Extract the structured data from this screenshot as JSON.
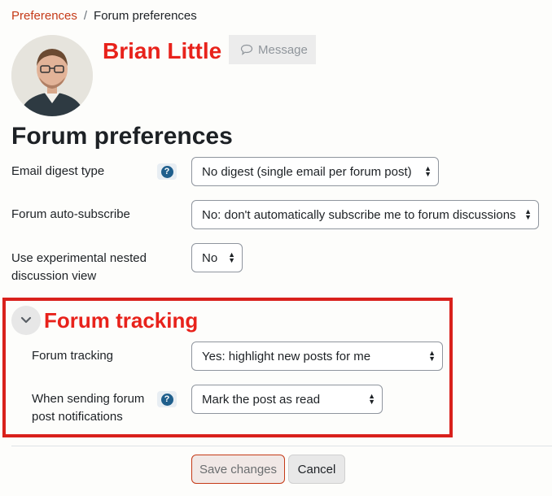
{
  "breadcrumb": {
    "items": [
      "Preferences",
      "Forum preferences"
    ],
    "separator": "/"
  },
  "user": {
    "name": "Brian Little",
    "message_button": "Message"
  },
  "page": {
    "title": "Forum preferences"
  },
  "fields": {
    "email_digest": {
      "label": "Email digest type",
      "value": "No digest (single email per forum post)"
    },
    "auto_subscribe": {
      "label": "Forum auto-subscribe",
      "value": "No: don't automatically subscribe me to forum discussions"
    },
    "nested_view": {
      "label_line1": "Use experimental nested",
      "label_line2": "discussion view",
      "value": "No"
    }
  },
  "tracking_section": {
    "title": "Forum tracking",
    "tracking": {
      "label": "Forum tracking",
      "value": "Yes: highlight new posts for me"
    },
    "notifications": {
      "label_line1": "When sending forum",
      "label_line2": "post notifications",
      "value": "Mark the post as read"
    }
  },
  "actions": {
    "save": "Save changes",
    "cancel": "Cancel"
  },
  "colors": {
    "accent": "#c53a17",
    "highlight_red": "#e8221b",
    "help_icon": "#1f5f8c"
  },
  "icons": [
    "speech-bubble-icon",
    "help-icon",
    "chevron-down-icon",
    "select-arrows-icon"
  ]
}
